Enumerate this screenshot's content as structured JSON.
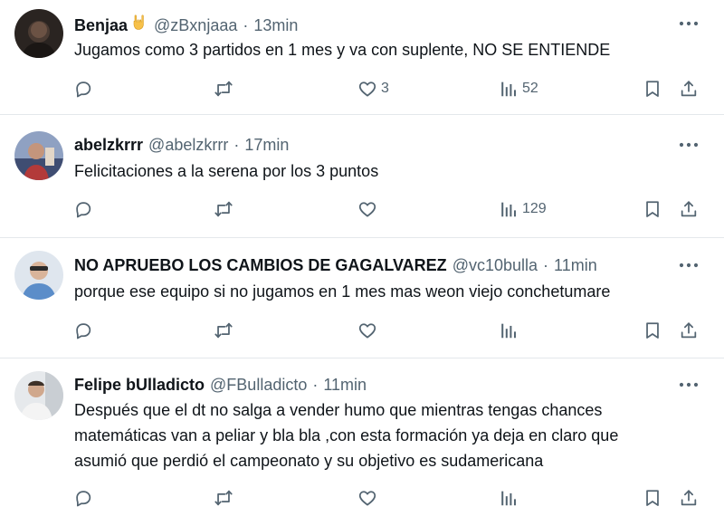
{
  "tweets": [
    {
      "name": "Benjaa",
      "handle": "@zBxnjaaa",
      "time": "13min",
      "name_emoji": "hand-horns-emoji",
      "text_lines": [
        "Jugamos como 3 partidos en 1 mes y va con suplente, NO SE ENTIENDE"
      ],
      "likes": "3",
      "views": "52"
    },
    {
      "name": "abelzkrrr",
      "handle": "@abelzkrrr",
      "time": "17min",
      "text_lines": [
        "Felicitaciones a la serena por los 3 puntos"
      ],
      "likes": "",
      "views": "129"
    },
    {
      "name": "NO APRUEBO LOS CAMBIOS DE GAGALVAREZ",
      "handle": "@vc10bulla",
      "time": "11min",
      "text_lines": [
        "porque ese equipo si no jugamos en 1 mes mas weon viejo conchetumare"
      ],
      "likes": "",
      "views": ""
    },
    {
      "name": "Felipe bUlladicto",
      "handle": "@FBulladicto",
      "time": "11min",
      "text_lines": [
        "Después que el dt no salga a vender humo que mientras tengas chances",
        "matemáticas van a peliar y bla bla ,con esta formación ya deja en claro que",
        "asumió que perdió el campeonato y su objetivo es sudamericana"
      ],
      "likes": "",
      "views": ""
    }
  ],
  "separator": "·",
  "icons": [
    "reply-icon",
    "retweet-icon",
    "like-icon",
    "views-icon",
    "bookmark-icon",
    "share-icon",
    "more-icon"
  ],
  "colors": {
    "text": "#0f1419",
    "secondary": "#536471",
    "divider": "#e4e8eb"
  }
}
